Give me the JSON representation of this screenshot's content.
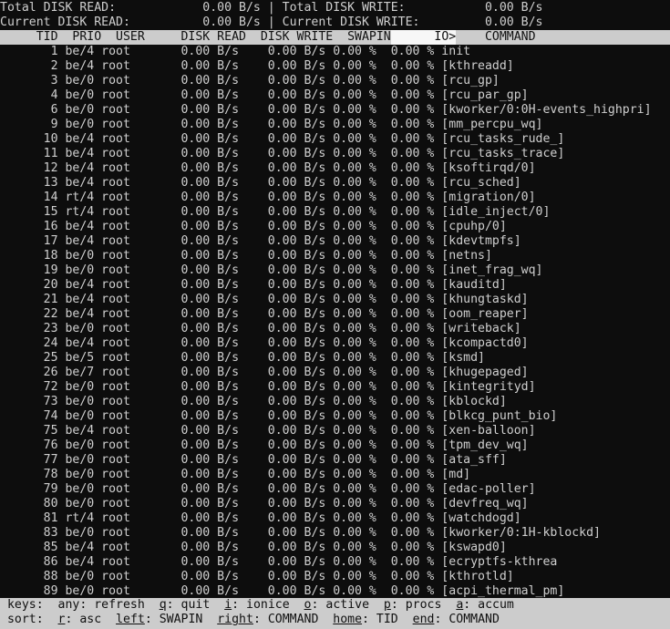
{
  "app": {
    "name": "iotop"
  },
  "colors": {
    "background": "#0d0d0d",
    "foreground": "#cfcfcf",
    "header_bg": "#cccccc",
    "header_fg": "#101010",
    "sorted_col_bg": "#f7f7f7"
  },
  "summary": {
    "rows": [
      {
        "left_label": "Total DISK READ:",
        "left_value": "0.00 B/s",
        "separator": "|",
        "right_label": "Total DISK WRITE:",
        "right_value": "0.00 B/s",
        "text": "Total DISK READ:            0.00 B/s | Total DISK WRITE:           0.00 B/s"
      },
      {
        "left_label": "Current DISK READ:",
        "left_value": "0.00 B/s",
        "separator": "|",
        "right_label": "Current DISK WRITE:",
        "right_value": "0.00 B/s",
        "text": "Current DISK READ:          0.00 B/s | Current DISK WRITE:         0.00 B/s"
      }
    ]
  },
  "table": {
    "headers": {
      "tid": "TID",
      "prio": "PRIO",
      "user": "USER",
      "disk_read": "DISK READ",
      "disk_write": "DISK WRITE",
      "swapin": "SWAPIN",
      "io": "IO>",
      "command": "COMMAND"
    },
    "header_before_sorted": "     TID  PRIO  USER     DISK READ  DISK WRITE  SWAPIN",
    "header_sorted": "      IO>",
    "header_after_sorted": "    COMMAND                                           ",
    "sorted_column": "IO>",
    "rows": [
      {
        "tid": "1",
        "prio": "be/4",
        "user": "root",
        "disk_read": "0.00 B/s",
        "disk_write": "0.00 B/s",
        "swapin": "0.00 %",
        "io": "0.00 %",
        "command": "init"
      },
      {
        "tid": "2",
        "prio": "be/4",
        "user": "root",
        "disk_read": "0.00 B/s",
        "disk_write": "0.00 B/s",
        "swapin": "0.00 %",
        "io": "0.00 %",
        "command": "[kthreadd]"
      },
      {
        "tid": "3",
        "prio": "be/0",
        "user": "root",
        "disk_read": "0.00 B/s",
        "disk_write": "0.00 B/s",
        "swapin": "0.00 %",
        "io": "0.00 %",
        "command": "[rcu_gp]"
      },
      {
        "tid": "4",
        "prio": "be/0",
        "user": "root",
        "disk_read": "0.00 B/s",
        "disk_write": "0.00 B/s",
        "swapin": "0.00 %",
        "io": "0.00 %",
        "command": "[rcu_par_gp]"
      },
      {
        "tid": "6",
        "prio": "be/0",
        "user": "root",
        "disk_read": "0.00 B/s",
        "disk_write": "0.00 B/s",
        "swapin": "0.00 %",
        "io": "0.00 %",
        "command": "[kworker/0:0H-events_highpri]"
      },
      {
        "tid": "9",
        "prio": "be/0",
        "user": "root",
        "disk_read": "0.00 B/s",
        "disk_write": "0.00 B/s",
        "swapin": "0.00 %",
        "io": "0.00 %",
        "command": "[mm_percpu_wq]"
      },
      {
        "tid": "10",
        "prio": "be/4",
        "user": "root",
        "disk_read": "0.00 B/s",
        "disk_write": "0.00 B/s",
        "swapin": "0.00 %",
        "io": "0.00 %",
        "command": "[rcu_tasks_rude_]"
      },
      {
        "tid": "11",
        "prio": "be/4",
        "user": "root",
        "disk_read": "0.00 B/s",
        "disk_write": "0.00 B/s",
        "swapin": "0.00 %",
        "io": "0.00 %",
        "command": "[rcu_tasks_trace]"
      },
      {
        "tid": "12",
        "prio": "be/4",
        "user": "root",
        "disk_read": "0.00 B/s",
        "disk_write": "0.00 B/s",
        "swapin": "0.00 %",
        "io": "0.00 %",
        "command": "[ksoftirqd/0]"
      },
      {
        "tid": "13",
        "prio": "be/4",
        "user": "root",
        "disk_read": "0.00 B/s",
        "disk_write": "0.00 B/s",
        "swapin": "0.00 %",
        "io": "0.00 %",
        "command": "[rcu_sched]"
      },
      {
        "tid": "14",
        "prio": "rt/4",
        "user": "root",
        "disk_read": "0.00 B/s",
        "disk_write": "0.00 B/s",
        "swapin": "0.00 %",
        "io": "0.00 %",
        "command": "[migration/0]"
      },
      {
        "tid": "15",
        "prio": "rt/4",
        "user": "root",
        "disk_read": "0.00 B/s",
        "disk_write": "0.00 B/s",
        "swapin": "0.00 %",
        "io": "0.00 %",
        "command": "[idle_inject/0]"
      },
      {
        "tid": "16",
        "prio": "be/4",
        "user": "root",
        "disk_read": "0.00 B/s",
        "disk_write": "0.00 B/s",
        "swapin": "0.00 %",
        "io": "0.00 %",
        "command": "[cpuhp/0]"
      },
      {
        "tid": "17",
        "prio": "be/4",
        "user": "root",
        "disk_read": "0.00 B/s",
        "disk_write": "0.00 B/s",
        "swapin": "0.00 %",
        "io": "0.00 %",
        "command": "[kdevtmpfs]"
      },
      {
        "tid": "18",
        "prio": "be/0",
        "user": "root",
        "disk_read": "0.00 B/s",
        "disk_write": "0.00 B/s",
        "swapin": "0.00 %",
        "io": "0.00 %",
        "command": "[netns]"
      },
      {
        "tid": "19",
        "prio": "be/0",
        "user": "root",
        "disk_read": "0.00 B/s",
        "disk_write": "0.00 B/s",
        "swapin": "0.00 %",
        "io": "0.00 %",
        "command": "[inet_frag_wq]"
      },
      {
        "tid": "20",
        "prio": "be/4",
        "user": "root",
        "disk_read": "0.00 B/s",
        "disk_write": "0.00 B/s",
        "swapin": "0.00 %",
        "io": "0.00 %",
        "command": "[kauditd]"
      },
      {
        "tid": "21",
        "prio": "be/4",
        "user": "root",
        "disk_read": "0.00 B/s",
        "disk_write": "0.00 B/s",
        "swapin": "0.00 %",
        "io": "0.00 %",
        "command": "[khungtaskd]"
      },
      {
        "tid": "22",
        "prio": "be/4",
        "user": "root",
        "disk_read": "0.00 B/s",
        "disk_write": "0.00 B/s",
        "swapin": "0.00 %",
        "io": "0.00 %",
        "command": "[oom_reaper]"
      },
      {
        "tid": "23",
        "prio": "be/0",
        "user": "root",
        "disk_read": "0.00 B/s",
        "disk_write": "0.00 B/s",
        "swapin": "0.00 %",
        "io": "0.00 %",
        "command": "[writeback]"
      },
      {
        "tid": "24",
        "prio": "be/4",
        "user": "root",
        "disk_read": "0.00 B/s",
        "disk_write": "0.00 B/s",
        "swapin": "0.00 %",
        "io": "0.00 %",
        "command": "[kcompactd0]"
      },
      {
        "tid": "25",
        "prio": "be/5",
        "user": "root",
        "disk_read": "0.00 B/s",
        "disk_write": "0.00 B/s",
        "swapin": "0.00 %",
        "io": "0.00 %",
        "command": "[ksmd]"
      },
      {
        "tid": "26",
        "prio": "be/7",
        "user": "root",
        "disk_read": "0.00 B/s",
        "disk_write": "0.00 B/s",
        "swapin": "0.00 %",
        "io": "0.00 %",
        "command": "[khugepaged]"
      },
      {
        "tid": "72",
        "prio": "be/0",
        "user": "root",
        "disk_read": "0.00 B/s",
        "disk_write": "0.00 B/s",
        "swapin": "0.00 %",
        "io": "0.00 %",
        "command": "[kintegrityd]"
      },
      {
        "tid": "73",
        "prio": "be/0",
        "user": "root",
        "disk_read": "0.00 B/s",
        "disk_write": "0.00 B/s",
        "swapin": "0.00 %",
        "io": "0.00 %",
        "command": "[kblockd]"
      },
      {
        "tid": "74",
        "prio": "be/0",
        "user": "root",
        "disk_read": "0.00 B/s",
        "disk_write": "0.00 B/s",
        "swapin": "0.00 %",
        "io": "0.00 %",
        "command": "[blkcg_punt_bio]"
      },
      {
        "tid": "75",
        "prio": "be/4",
        "user": "root",
        "disk_read": "0.00 B/s",
        "disk_write": "0.00 B/s",
        "swapin": "0.00 %",
        "io": "0.00 %",
        "command": "[xen-balloon]"
      },
      {
        "tid": "76",
        "prio": "be/0",
        "user": "root",
        "disk_read": "0.00 B/s",
        "disk_write": "0.00 B/s",
        "swapin": "0.00 %",
        "io": "0.00 %",
        "command": "[tpm_dev_wq]"
      },
      {
        "tid": "77",
        "prio": "be/0",
        "user": "root",
        "disk_read": "0.00 B/s",
        "disk_write": "0.00 B/s",
        "swapin": "0.00 %",
        "io": "0.00 %",
        "command": "[ata_sff]"
      },
      {
        "tid": "78",
        "prio": "be/0",
        "user": "root",
        "disk_read": "0.00 B/s",
        "disk_write": "0.00 B/s",
        "swapin": "0.00 %",
        "io": "0.00 %",
        "command": "[md]"
      },
      {
        "tid": "79",
        "prio": "be/0",
        "user": "root",
        "disk_read": "0.00 B/s",
        "disk_write": "0.00 B/s",
        "swapin": "0.00 %",
        "io": "0.00 %",
        "command": "[edac-poller]"
      },
      {
        "tid": "80",
        "prio": "be/0",
        "user": "root",
        "disk_read": "0.00 B/s",
        "disk_write": "0.00 B/s",
        "swapin": "0.00 %",
        "io": "0.00 %",
        "command": "[devfreq_wq]"
      },
      {
        "tid": "81",
        "prio": "rt/4",
        "user": "root",
        "disk_read": "0.00 B/s",
        "disk_write": "0.00 B/s",
        "swapin": "0.00 %",
        "io": "0.00 %",
        "command": "[watchdogd]"
      },
      {
        "tid": "83",
        "prio": "be/0",
        "user": "root",
        "disk_read": "0.00 B/s",
        "disk_write": "0.00 B/s",
        "swapin": "0.00 %",
        "io": "0.00 %",
        "command": "[kworker/0:1H-kblockd]"
      },
      {
        "tid": "85",
        "prio": "be/4",
        "user": "root",
        "disk_read": "0.00 B/s",
        "disk_write": "0.00 B/s",
        "swapin": "0.00 %",
        "io": "0.00 %",
        "command": "[kswapd0]"
      },
      {
        "tid": "86",
        "prio": "be/4",
        "user": "root",
        "disk_read": "0.00 B/s",
        "disk_write": "0.00 B/s",
        "swapin": "0.00 %",
        "io": "0.00 %",
        "command": "[ecryptfs-kthrea"
      },
      {
        "tid": "88",
        "prio": "be/0",
        "user": "root",
        "disk_read": "0.00 B/s",
        "disk_write": "0.00 B/s",
        "swapin": "0.00 %",
        "io": "0.00 %",
        "command": "[kthrotld]"
      },
      {
        "tid": "89",
        "prio": "be/0",
        "user": "root",
        "disk_read": "0.00 B/s",
        "disk_write": "0.00 B/s",
        "swapin": "0.00 %",
        "io": "0.00 %",
        "command": "[acpi_thermal_pm]"
      }
    ]
  },
  "footer": {
    "keys_label": "keys:",
    "sort_label": "sort:",
    "keys": [
      {
        "key": "any",
        "underline": "",
        "action": "refresh"
      },
      {
        "key": "q",
        "underline": "q",
        "action": "quit"
      },
      {
        "key": "i",
        "underline": "i",
        "action": "ionice"
      },
      {
        "key": "o",
        "underline": "o",
        "action": "active"
      },
      {
        "key": "p",
        "underline": "p",
        "action": "procs"
      },
      {
        "key": "a",
        "underline": "a",
        "action": "accum"
      }
    ],
    "sort": [
      {
        "key": "r",
        "underline": "r",
        "action": "asc"
      },
      {
        "key": "left",
        "underline": "left",
        "action": "SWAPIN"
      },
      {
        "key": "right",
        "underline": "right",
        "action": "COMMAND"
      },
      {
        "key": "home",
        "underline": "home",
        "action": "TID"
      },
      {
        "key": "end",
        "underline": "end",
        "action": "COMMAND"
      }
    ]
  }
}
